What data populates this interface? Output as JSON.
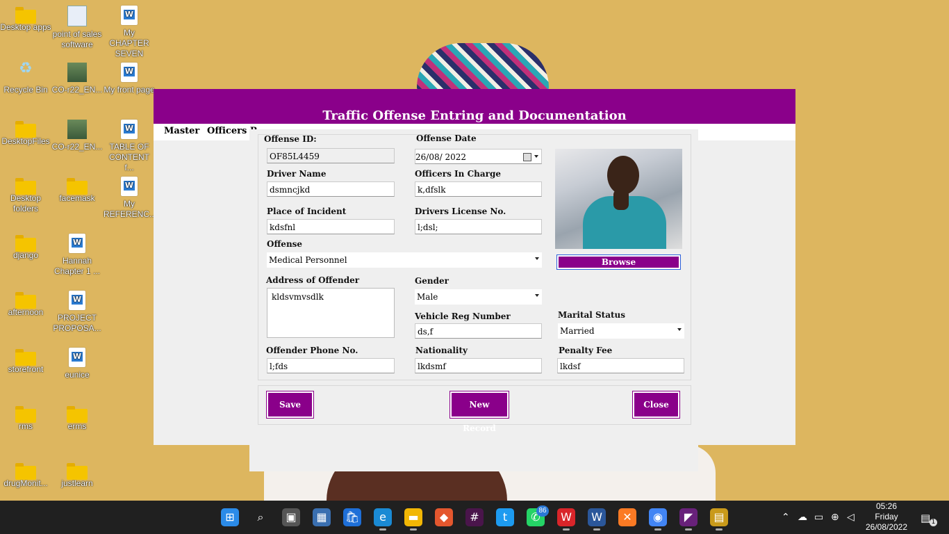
{
  "desktop": {
    "icons": [
      {
        "label": "Desktop apps",
        "kind": "folder"
      },
      {
        "label": "point of sales software",
        "kind": "app"
      },
      {
        "label": "My CHAPTER SEVEN",
        "kind": "word"
      },
      {
        "label": "Recycle Bin",
        "kind": "bin"
      },
      {
        "label": "CO-r22_EN...",
        "kind": "photo"
      },
      {
        "label": "My front page",
        "kind": "word"
      },
      {
        "label": "DesktopFiles",
        "kind": "folder"
      },
      {
        "label": "CO-r22_EN...",
        "kind": "photo"
      },
      {
        "label": "TABLE OF CONTENT f...",
        "kind": "word"
      },
      {
        "label": "Desktop folders",
        "kind": "folder"
      },
      {
        "label": "facemask",
        "kind": "folder"
      },
      {
        "label": "My REFERENC...",
        "kind": "word"
      },
      {
        "label": "django",
        "kind": "folder"
      },
      {
        "label": "Hannah Chapter 1 ...",
        "kind": "word"
      },
      {
        "label": "afternoon",
        "kind": "folder"
      },
      {
        "label": "PROJECT PROPOSA...",
        "kind": "word"
      },
      {
        "label": "storefront",
        "kind": "folder"
      },
      {
        "label": "eunice",
        "kind": "word"
      },
      {
        "label": "rms",
        "kind": "folder"
      },
      {
        "label": "erms",
        "kind": "folder"
      },
      {
        "label": "drugMonit...",
        "kind": "folder"
      },
      {
        "label": "justlearn",
        "kind": "folder"
      }
    ]
  },
  "app": {
    "title": "Traffic Offense Entring and Documentation",
    "menu": [
      "Master",
      "Officers R"
    ],
    "form": {
      "offense_id": {
        "label": "Offense ID:",
        "value": "OF85L4459"
      },
      "offense_date": {
        "label": "Offense Date",
        "value": "26/08/ 2022"
      },
      "driver_name": {
        "label": "Driver Name",
        "value": "dsmncjkd"
      },
      "officers_in_charge": {
        "label": "Officers In Charge",
        "value": "k,dfslk"
      },
      "place_of_incident": {
        "label": "Place of Incident",
        "value": "kdsfnl"
      },
      "drivers_license": {
        "label": "Drivers License No.",
        "value": "l;dsl;"
      },
      "offense": {
        "label": "Offense",
        "value": "Medical Personnel"
      },
      "address": {
        "label": "Address of Offender",
        "value": "kldsvmvsdlk"
      },
      "gender": {
        "label": "Gender",
        "value": "Male"
      },
      "vehicle_reg": {
        "label": "Vehicle Reg Number",
        "value": "ds,f"
      },
      "marital_status": {
        "label": "Marital Status",
        "value": "Married"
      },
      "phone": {
        "label": "Offender Phone No.",
        "value": "l;fds"
      },
      "nationality": {
        "label": "Nationality",
        "value": "lkdsmf"
      },
      "penalty_fee": {
        "label": "Penalty Fee",
        "value": "lkdsf"
      }
    },
    "browse_label": "Browse",
    "buttons": {
      "save": "Save",
      "new_record": "New Record",
      "close": "Close"
    },
    "accent_color": "#8a008a"
  },
  "taskbar": {
    "icons": [
      "windows-start",
      "search",
      "task-view",
      "widgets",
      "microsoft-store",
      "edge",
      "file-explorer",
      "git",
      "slack",
      "twitter",
      "whatsapp",
      "wps-office",
      "word",
      "xampp",
      "chrome",
      "visual-studio",
      "running-app"
    ],
    "whatsapp_badge": "86",
    "clock": {
      "time": "05:26",
      "day": "Friday",
      "date": "26/08/2022"
    },
    "notification_count": "1"
  }
}
